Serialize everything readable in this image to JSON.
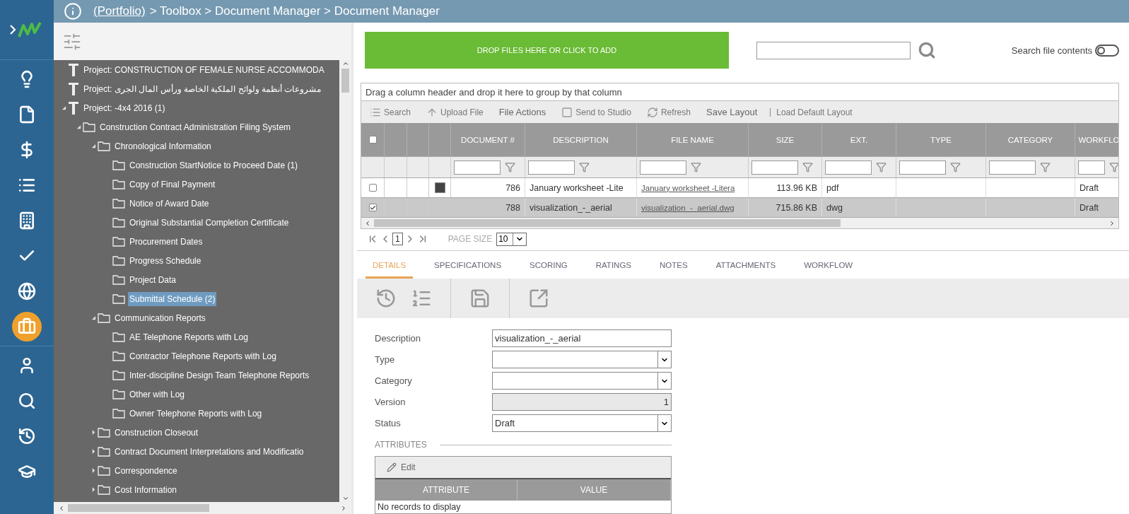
{
  "breadcrumb": {
    "root": "(Portfolio)",
    "path": "> Toolbox > Document Manager > Document Manager"
  },
  "nav": {
    "groups": [
      {
        "items": [
          {
            "selected": false
          },
          {
            "selected": false
          },
          {
            "selected": false
          },
          {
            "selected": false
          },
          {
            "selected": false
          },
          {
            "selected": false
          },
          {
            "selected": false
          },
          {
            "selected": true
          }
        ]
      },
      {
        "items": [
          {
            "selected": false
          },
          {
            "selected": false
          },
          {
            "selected": false
          },
          {
            "selected": false
          }
        ]
      }
    ]
  },
  "tree": [
    {
      "kind": "project",
      "label": "Project: CONSTRUCTION OF FEMALE NURSE ACCOMMODA",
      "selected": false
    },
    {
      "kind": "project",
      "label": "Project: مشروعات أنظمة ولوائح الملكية الخاصة ورأس المال الجرى",
      "selected": false
    },
    {
      "kind": "project",
      "label": "Project: -4x4 2016 (1)",
      "selected": false,
      "expanded": true,
      "children": [
        {
          "kind": "folder",
          "label": "Construction Contract Administration Filing System",
          "selected": false,
          "expanded": true,
          "children": [
            {
              "kind": "folder",
              "label": "Chronological Information",
              "selected": false,
              "expanded": true,
              "children": [
                {
                  "kind": "folder",
                  "label": "Construction StartNotice to Proceed Date (1)",
                  "selected": false
                },
                {
                  "kind": "folder",
                  "label": "Copy of Final Payment",
                  "selected": false
                },
                {
                  "kind": "folder",
                  "label": "Notice of Award Date",
                  "selected": false
                },
                {
                  "kind": "folder",
                  "label": "Original Substantial Completion Certificate",
                  "selected": false
                },
                {
                  "kind": "folder",
                  "label": "Procurement Dates",
                  "selected": false
                },
                {
                  "kind": "folder",
                  "label": "Progress Schedule",
                  "selected": false
                },
                {
                  "kind": "folder",
                  "label": "Project Data",
                  "selected": false
                },
                {
                  "kind": "folder",
                  "label": "Submittal Schedule (2)",
                  "selected": true
                }
              ]
            },
            {
              "kind": "folder",
              "label": "Communication Reports",
              "selected": false,
              "expanded": true,
              "children": [
                {
                  "kind": "folder",
                  "label": "AE Telephone Reports with Log",
                  "selected": false
                },
                {
                  "kind": "folder",
                  "label": "Contractor Telephone Reports with Log",
                  "selected": false
                },
                {
                  "kind": "folder",
                  "label": "Inter-discipline Design Team Telephone Reports",
                  "selected": false
                },
                {
                  "kind": "folder",
                  "label": "Other with Log",
                  "selected": false
                },
                {
                  "kind": "folder",
                  "label": "Owner Telephone Reports with Log",
                  "selected": false
                }
              ]
            },
            {
              "kind": "folder",
              "label": "Construction Closeout",
              "selected": false,
              "expanded": false
            },
            {
              "kind": "folder",
              "label": "Contract Document Interpretations and Modificatio",
              "selected": false,
              "expanded": false
            },
            {
              "kind": "folder",
              "label": "Correspondence",
              "selected": false,
              "expanded": false
            },
            {
              "kind": "folder",
              "label": "Cost Information",
              "selected": false,
              "expanded": false
            }
          ]
        }
      ]
    }
  ],
  "dropzone": "DROP FILES HERE OR CLICK TO ADD",
  "search_file_contents": {
    "label": "Search file contents",
    "on": false
  },
  "group_hint": "Drag a column header and drop it here to group by that column",
  "toolbar": [
    {
      "kind": "search",
      "label": "Search"
    },
    {
      "kind": "upload",
      "label": "Upload File"
    },
    {
      "kind": "plain",
      "label": "File Actions"
    },
    {
      "kind": "studio",
      "label": "Send to Studio"
    },
    {
      "kind": "refresh",
      "label": "Refresh"
    },
    {
      "kind": "plain",
      "label": "Save Layout"
    },
    {
      "kind": "divided",
      "label": "Load Default Layout"
    }
  ],
  "select_all": {
    "checked": false
  },
  "columns": [
    {
      "label": "DOCUMENT #",
      "kind": "number"
    },
    {
      "label": "DESCRIPTION",
      "kind": "text"
    },
    {
      "label": "FILE NAME",
      "kind": "link"
    },
    {
      "label": "SIZE",
      "kind": "number"
    },
    {
      "label": "EXT.",
      "kind": "text"
    },
    {
      "label": "TYPE",
      "kind": "text"
    },
    {
      "label": "CATEGORY",
      "kind": "text"
    },
    {
      "label": "WORKFLO",
      "kind": "text"
    }
  ],
  "rows": [
    {
      "checked": false,
      "selected": false,
      "thumbnail": true,
      "cells": [
        "786",
        "January worksheet -Lite",
        "January worksheet -Litera",
        "113.96 KB",
        "pdf",
        null,
        null,
        "Draft"
      ]
    },
    {
      "checked": true,
      "selected": true,
      "thumbnail": false,
      "cells": [
        "788",
        "visualization_-_aerial",
        "visualization_-_aerial.dwg",
        "715.86 KB",
        "dwg",
        null,
        null,
        "Draft"
      ]
    }
  ],
  "pager": {
    "page": "1",
    "size_label": "PAGE SIZE",
    "size": "10"
  },
  "tabs": [
    {
      "label": "DETAILS",
      "selected": true
    },
    {
      "label": "SPECIFICATIONS",
      "selected": false
    },
    {
      "label": "SCORING",
      "selected": false
    },
    {
      "label": "RATINGS",
      "selected": false
    },
    {
      "label": "NOTES",
      "selected": false
    },
    {
      "label": "ATTACHMENTS",
      "selected": false
    },
    {
      "label": "WORKFLOW",
      "selected": false
    }
  ],
  "form": [
    {
      "label": "Description",
      "kind": "text",
      "value": "visualization_-_aerial",
      "disabled": false
    },
    {
      "label": "Type",
      "kind": "select",
      "disabled": false
    },
    {
      "label": "Category",
      "kind": "select",
      "disabled": false
    },
    {
      "label": "Version",
      "kind": "number",
      "value": "1",
      "disabled": true
    },
    {
      "label": "Status",
      "kind": "select",
      "value": "Draft",
      "disabled": false
    }
  ],
  "attributes": {
    "title": "ATTRIBUTES",
    "edit": "Edit",
    "columns": [
      "ATTRIBUTE",
      "VALUE"
    ],
    "empty": "No records to display"
  }
}
